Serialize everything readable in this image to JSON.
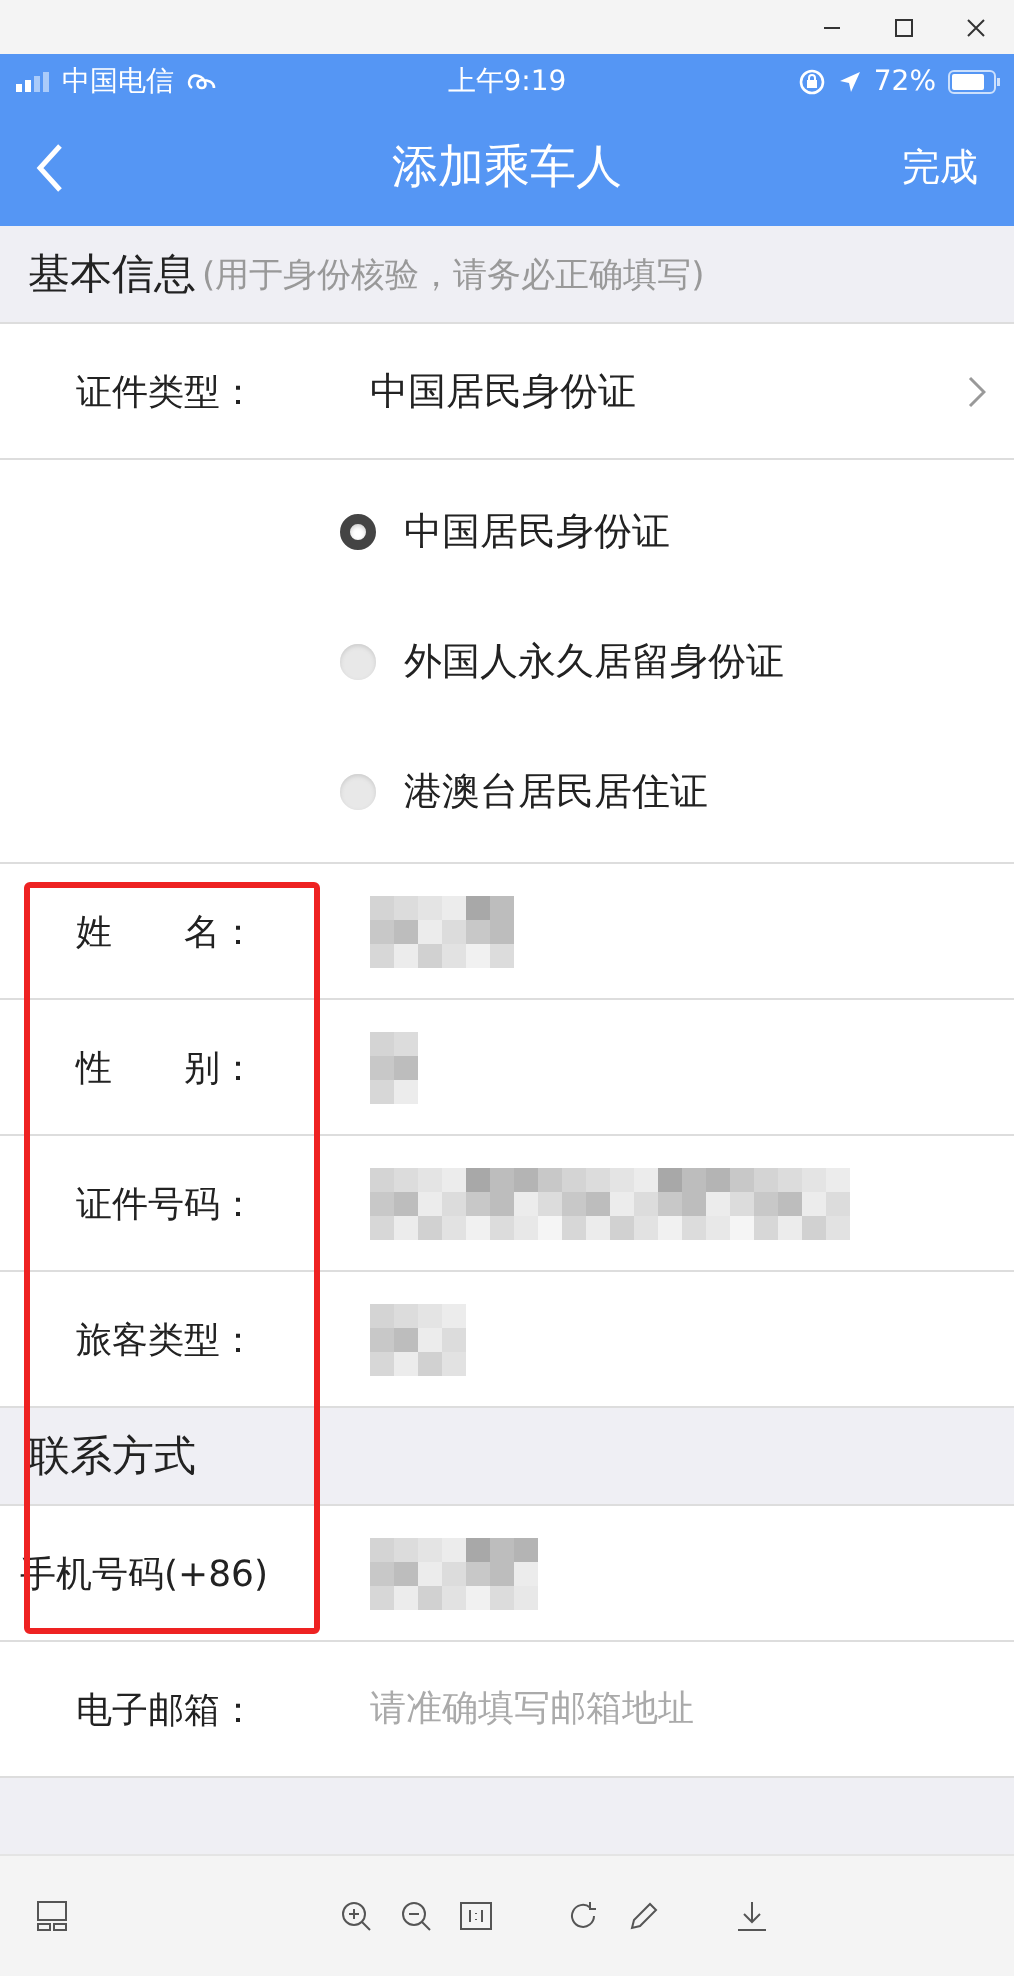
{
  "window": {
    "controls": [
      {
        "kind": "minimize"
      },
      {
        "kind": "maximize"
      },
      {
        "kind": "close"
      }
    ]
  },
  "status_bar": {
    "carrier": "中国电信",
    "time": "上午9:19",
    "battery": "72%"
  },
  "nav": {
    "title": "添加乘车人",
    "action": "完成"
  },
  "sections": [
    {
      "title": "基本信息",
      "hint": "(用于身份核验，请务必正确填写)",
      "rows": [
        {
          "kind": "select",
          "label": "证件类型：",
          "value": "中国居民身份证"
        },
        {
          "kind": "radios",
          "options": [
            {
              "label": "中国居民身份证",
              "selected": true
            },
            {
              "label": "外国人永久居留身份证",
              "selected": false
            },
            {
              "label": "港澳台居民居住证",
              "selected": false
            }
          ]
        },
        {
          "kind": "blurred",
          "label": "姓　　名："
        },
        {
          "kind": "blurred",
          "label": "性　　别："
        },
        {
          "kind": "blurred",
          "label": "证件号码："
        },
        {
          "kind": "blurred",
          "label": "旅客类型："
        }
      ]
    },
    {
      "title": "联系方式",
      "rows": [
        {
          "kind": "blurred",
          "label": "手机号码(+86)"
        },
        {
          "kind": "input",
          "label": "电子邮箱：",
          "placeholder": "请准确填写邮箱地址"
        }
      ]
    }
  ],
  "toolbar": [
    {
      "kind": "thumbnails"
    },
    {
      "kind": "zoom-in"
    },
    {
      "kind": "zoom-out"
    },
    {
      "kind": "actual-size"
    },
    {
      "kind": "rotate"
    },
    {
      "kind": "edit"
    },
    {
      "kind": "download"
    }
  ]
}
